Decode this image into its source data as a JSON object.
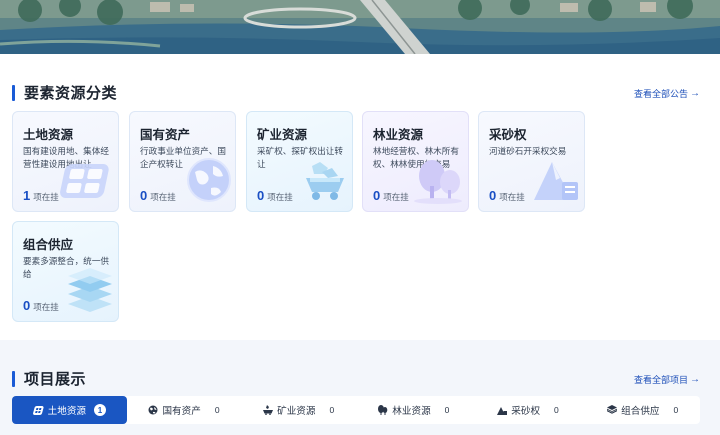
{
  "section1": {
    "title": "要素资源分类",
    "link": "查看全部公告",
    "link_arrow": "→"
  },
  "cards": [
    {
      "title": "土地资源",
      "desc": "国有建设用地、集体经营性建设用地出让",
      "count": "1",
      "unit": "项在挂",
      "icon": "land-icon"
    },
    {
      "title": "国有资产",
      "desc": "行政事业单位资产、国企产权转让",
      "count": "0",
      "unit": "项在挂",
      "icon": "globe-icon"
    },
    {
      "title": "矿业资源",
      "desc": "采矿权、探矿权出让转让",
      "count": "0",
      "unit": "项在挂",
      "icon": "mining-cart-icon"
    },
    {
      "title": "林业资源",
      "desc": "林地经营权、林木所有权、林林使用权交易",
      "count": "0",
      "unit": "项在挂",
      "icon": "tree-icon"
    },
    {
      "title": "采砂权",
      "desc": "河道砂石开采权交易",
      "count": "0",
      "unit": "项在挂",
      "icon": "sand-mountain-icon"
    },
    {
      "title": "组合供应",
      "desc": "要素多源整合，统一供给",
      "count": "0",
      "unit": "项在挂",
      "icon": "layers-icon"
    }
  ],
  "section2": {
    "title": "项目展示",
    "link": "查看全部项目",
    "link_arrow": "→"
  },
  "tabs": [
    {
      "label": "土地资源",
      "count": "1",
      "icon": "land-icon",
      "active": true
    },
    {
      "label": "国有资产",
      "count": "0",
      "icon": "globe-icon"
    },
    {
      "label": "矿业资源",
      "count": "0",
      "icon": "mining-icon"
    },
    {
      "label": "林业资源",
      "count": "0",
      "icon": "tree-icon"
    },
    {
      "label": "采砂权",
      "count": "0",
      "icon": "sand-icon"
    },
    {
      "label": "组合供应",
      "count": "0",
      "icon": "layers-icon"
    }
  ],
  "colors": {
    "accent": "#1a56c2",
    "count": "#1a4fc4",
    "card_bg": "#f0f4fc"
  }
}
